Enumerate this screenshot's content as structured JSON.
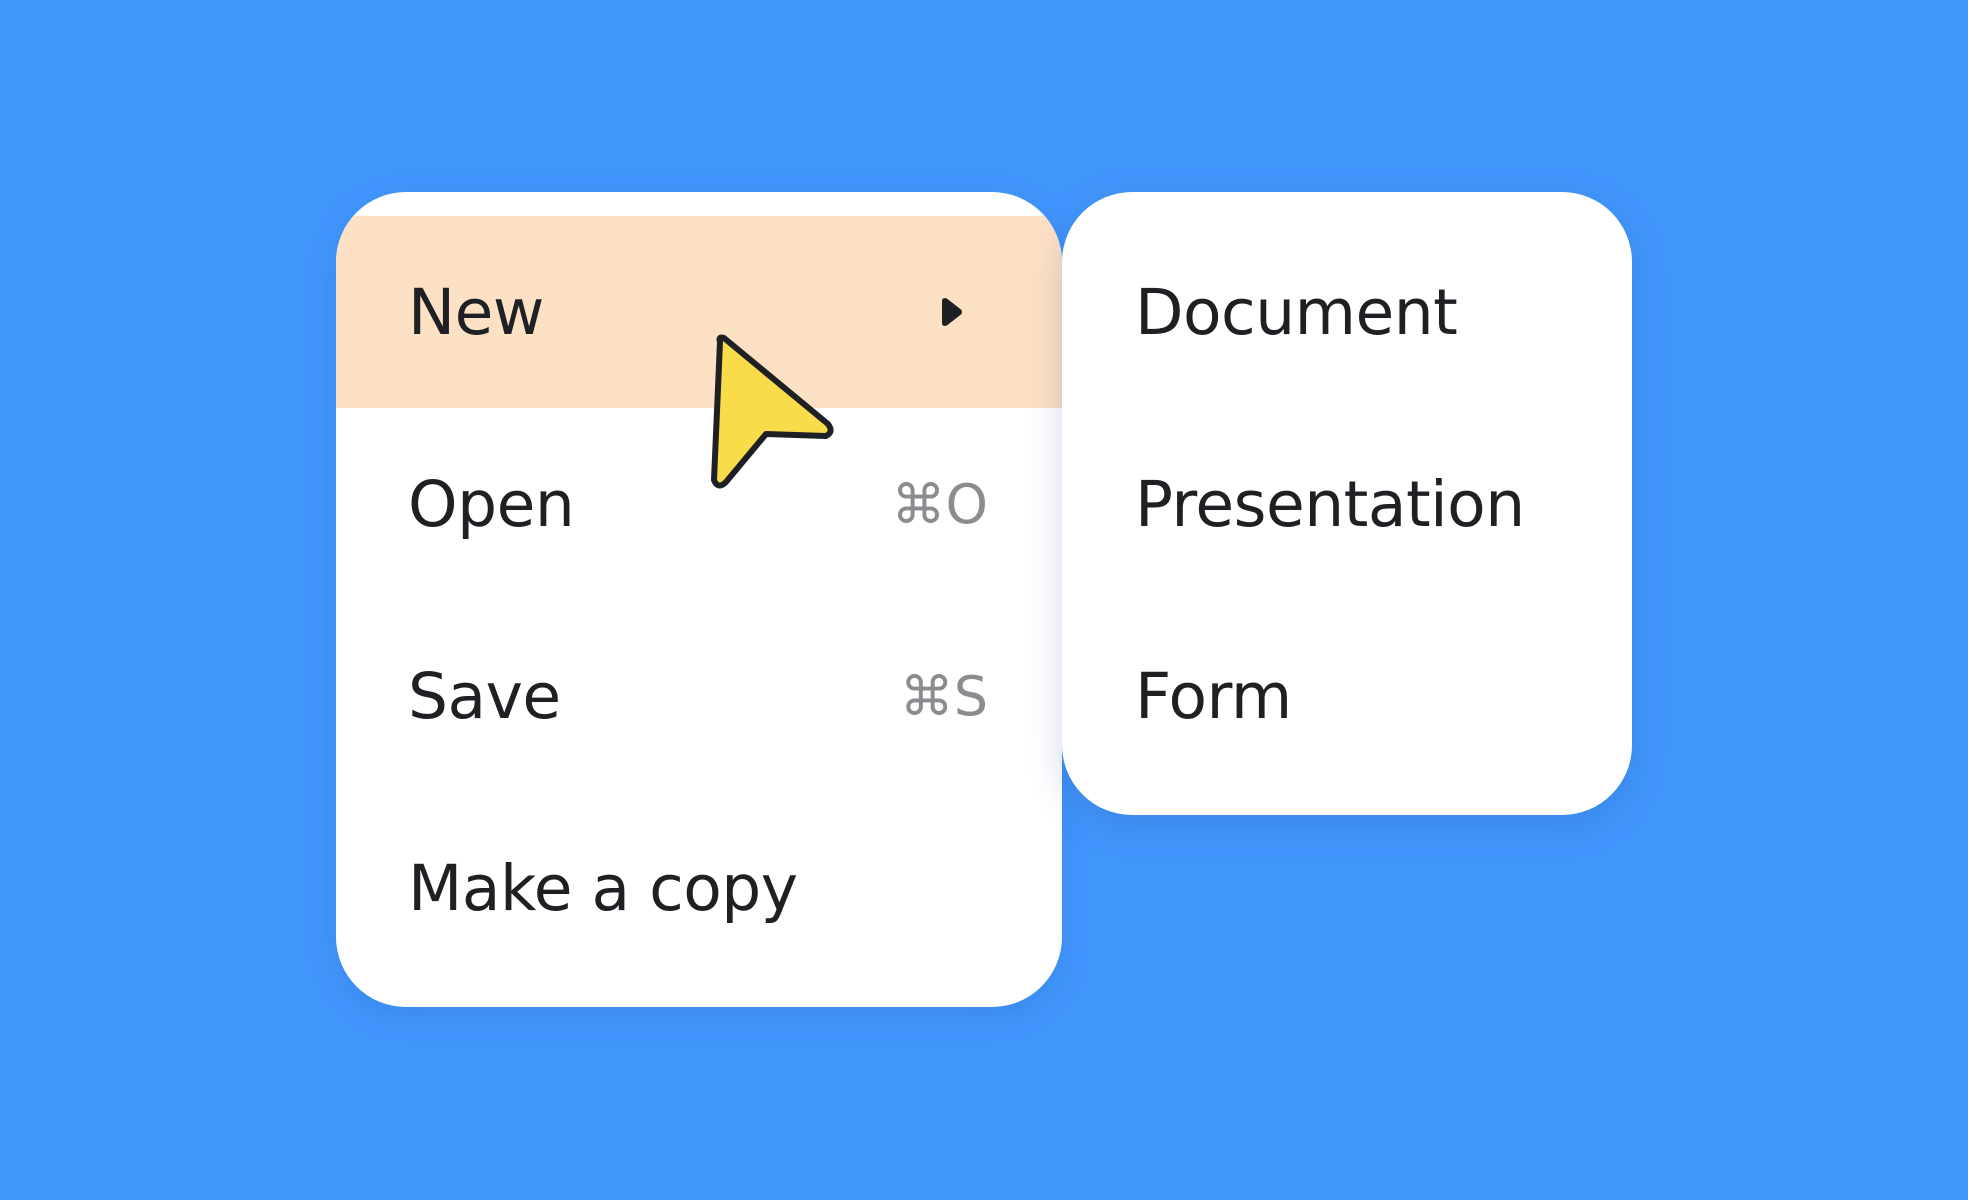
{
  "colors": {
    "background": "#4196fc",
    "menu_background": "#ffffff",
    "highlight": "#fde1c5",
    "text": "#1f2024",
    "shortcut_text": "#8c8c90",
    "cursor_fill": "#f8dc4a",
    "cursor_outline": "#1f2024"
  },
  "menu": {
    "items": [
      {
        "label": "New",
        "shortcut": "",
        "has_submenu": true,
        "highlighted": true,
        "submenu_icon": "caret-right-icon"
      },
      {
        "label": "Open",
        "shortcut": "⌘O"
      },
      {
        "label": "Save",
        "shortcut": "⌘S"
      },
      {
        "label": "Make a copy",
        "shortcut": ""
      }
    ]
  },
  "submenu": {
    "items": [
      {
        "label": "Document"
      },
      {
        "label": "Presentation"
      },
      {
        "label": "Form"
      }
    ]
  },
  "cursor": {
    "icon": "pointer-arrow-icon"
  }
}
